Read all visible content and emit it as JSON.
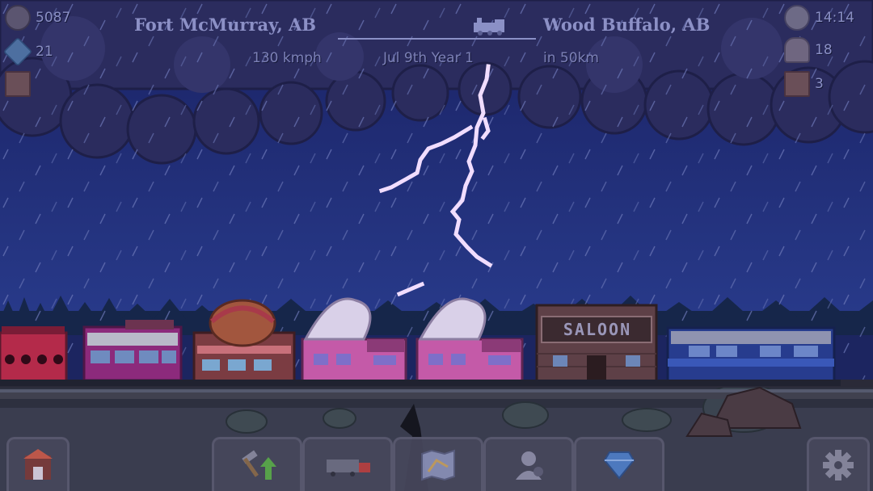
{
  "hud": {
    "coins": "5087",
    "gems": "21",
    "time": "14:14",
    "passengers": "18",
    "cargo": "3"
  },
  "route": {
    "origin": "Fort McMurray, AB",
    "destination": "Wood Buffalo, AB",
    "speed": "130 kmph",
    "date": "Jul 9th Year 1",
    "distance": "in 50km",
    "progress_fraction": 0.85
  },
  "train": {
    "saloon_sign": "SALOON"
  },
  "toolbar": {
    "buttons": [
      "station",
      "build-upgrade",
      "train-manage",
      "map",
      "crew",
      "gem-shop",
      "settings"
    ]
  },
  "colors": {
    "sky": "#1f2a6a",
    "clouds": "#2b2b5c",
    "lightning": "#f0dcff",
    "rail": "#2a2b3a",
    "ground": "#2f3140"
  }
}
